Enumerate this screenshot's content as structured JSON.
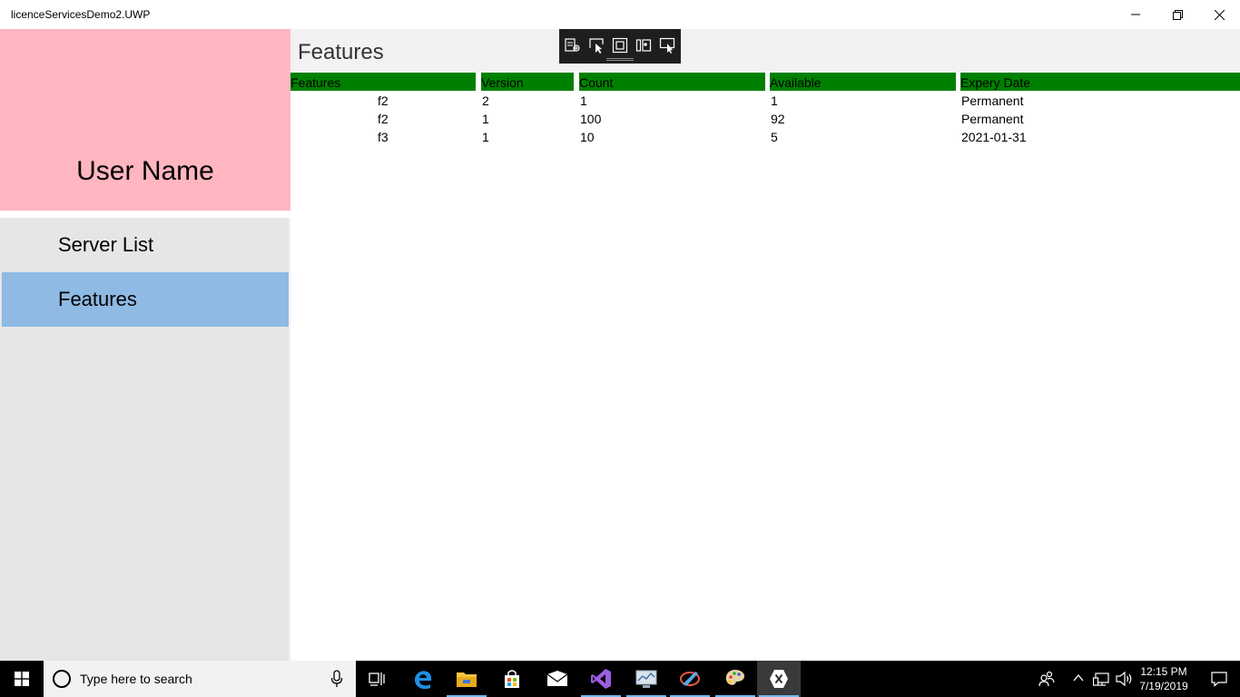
{
  "window": {
    "title": "licenceServicesDemo2.UWP"
  },
  "sidebar": {
    "user_name": "User Name",
    "items": [
      {
        "label": "Server List",
        "selected": false
      },
      {
        "label": "Features",
        "selected": true
      }
    ]
  },
  "content": {
    "page_title": "Features",
    "table": {
      "columns": [
        "Features",
        "Version",
        "Count",
        "Available",
        "Expery Date"
      ],
      "rows": [
        [
          "f2",
          "2",
          "1",
          "1",
          "Permanent"
        ],
        [
          "f2",
          "1",
          "100",
          "92",
          "Permanent"
        ],
        [
          "f3",
          "1",
          "10",
          "5",
          "2021-01-31"
        ]
      ]
    }
  },
  "taskbar": {
    "search_placeholder": "Type here to search",
    "clock_time": "12:15 PM",
    "clock_date": "7/19/2019"
  },
  "colors": {
    "user_panel": "#ffb6c1",
    "nav_selected": "#8ebae3",
    "header_green": "#008000",
    "pane_bg": "#e6e6e6"
  }
}
